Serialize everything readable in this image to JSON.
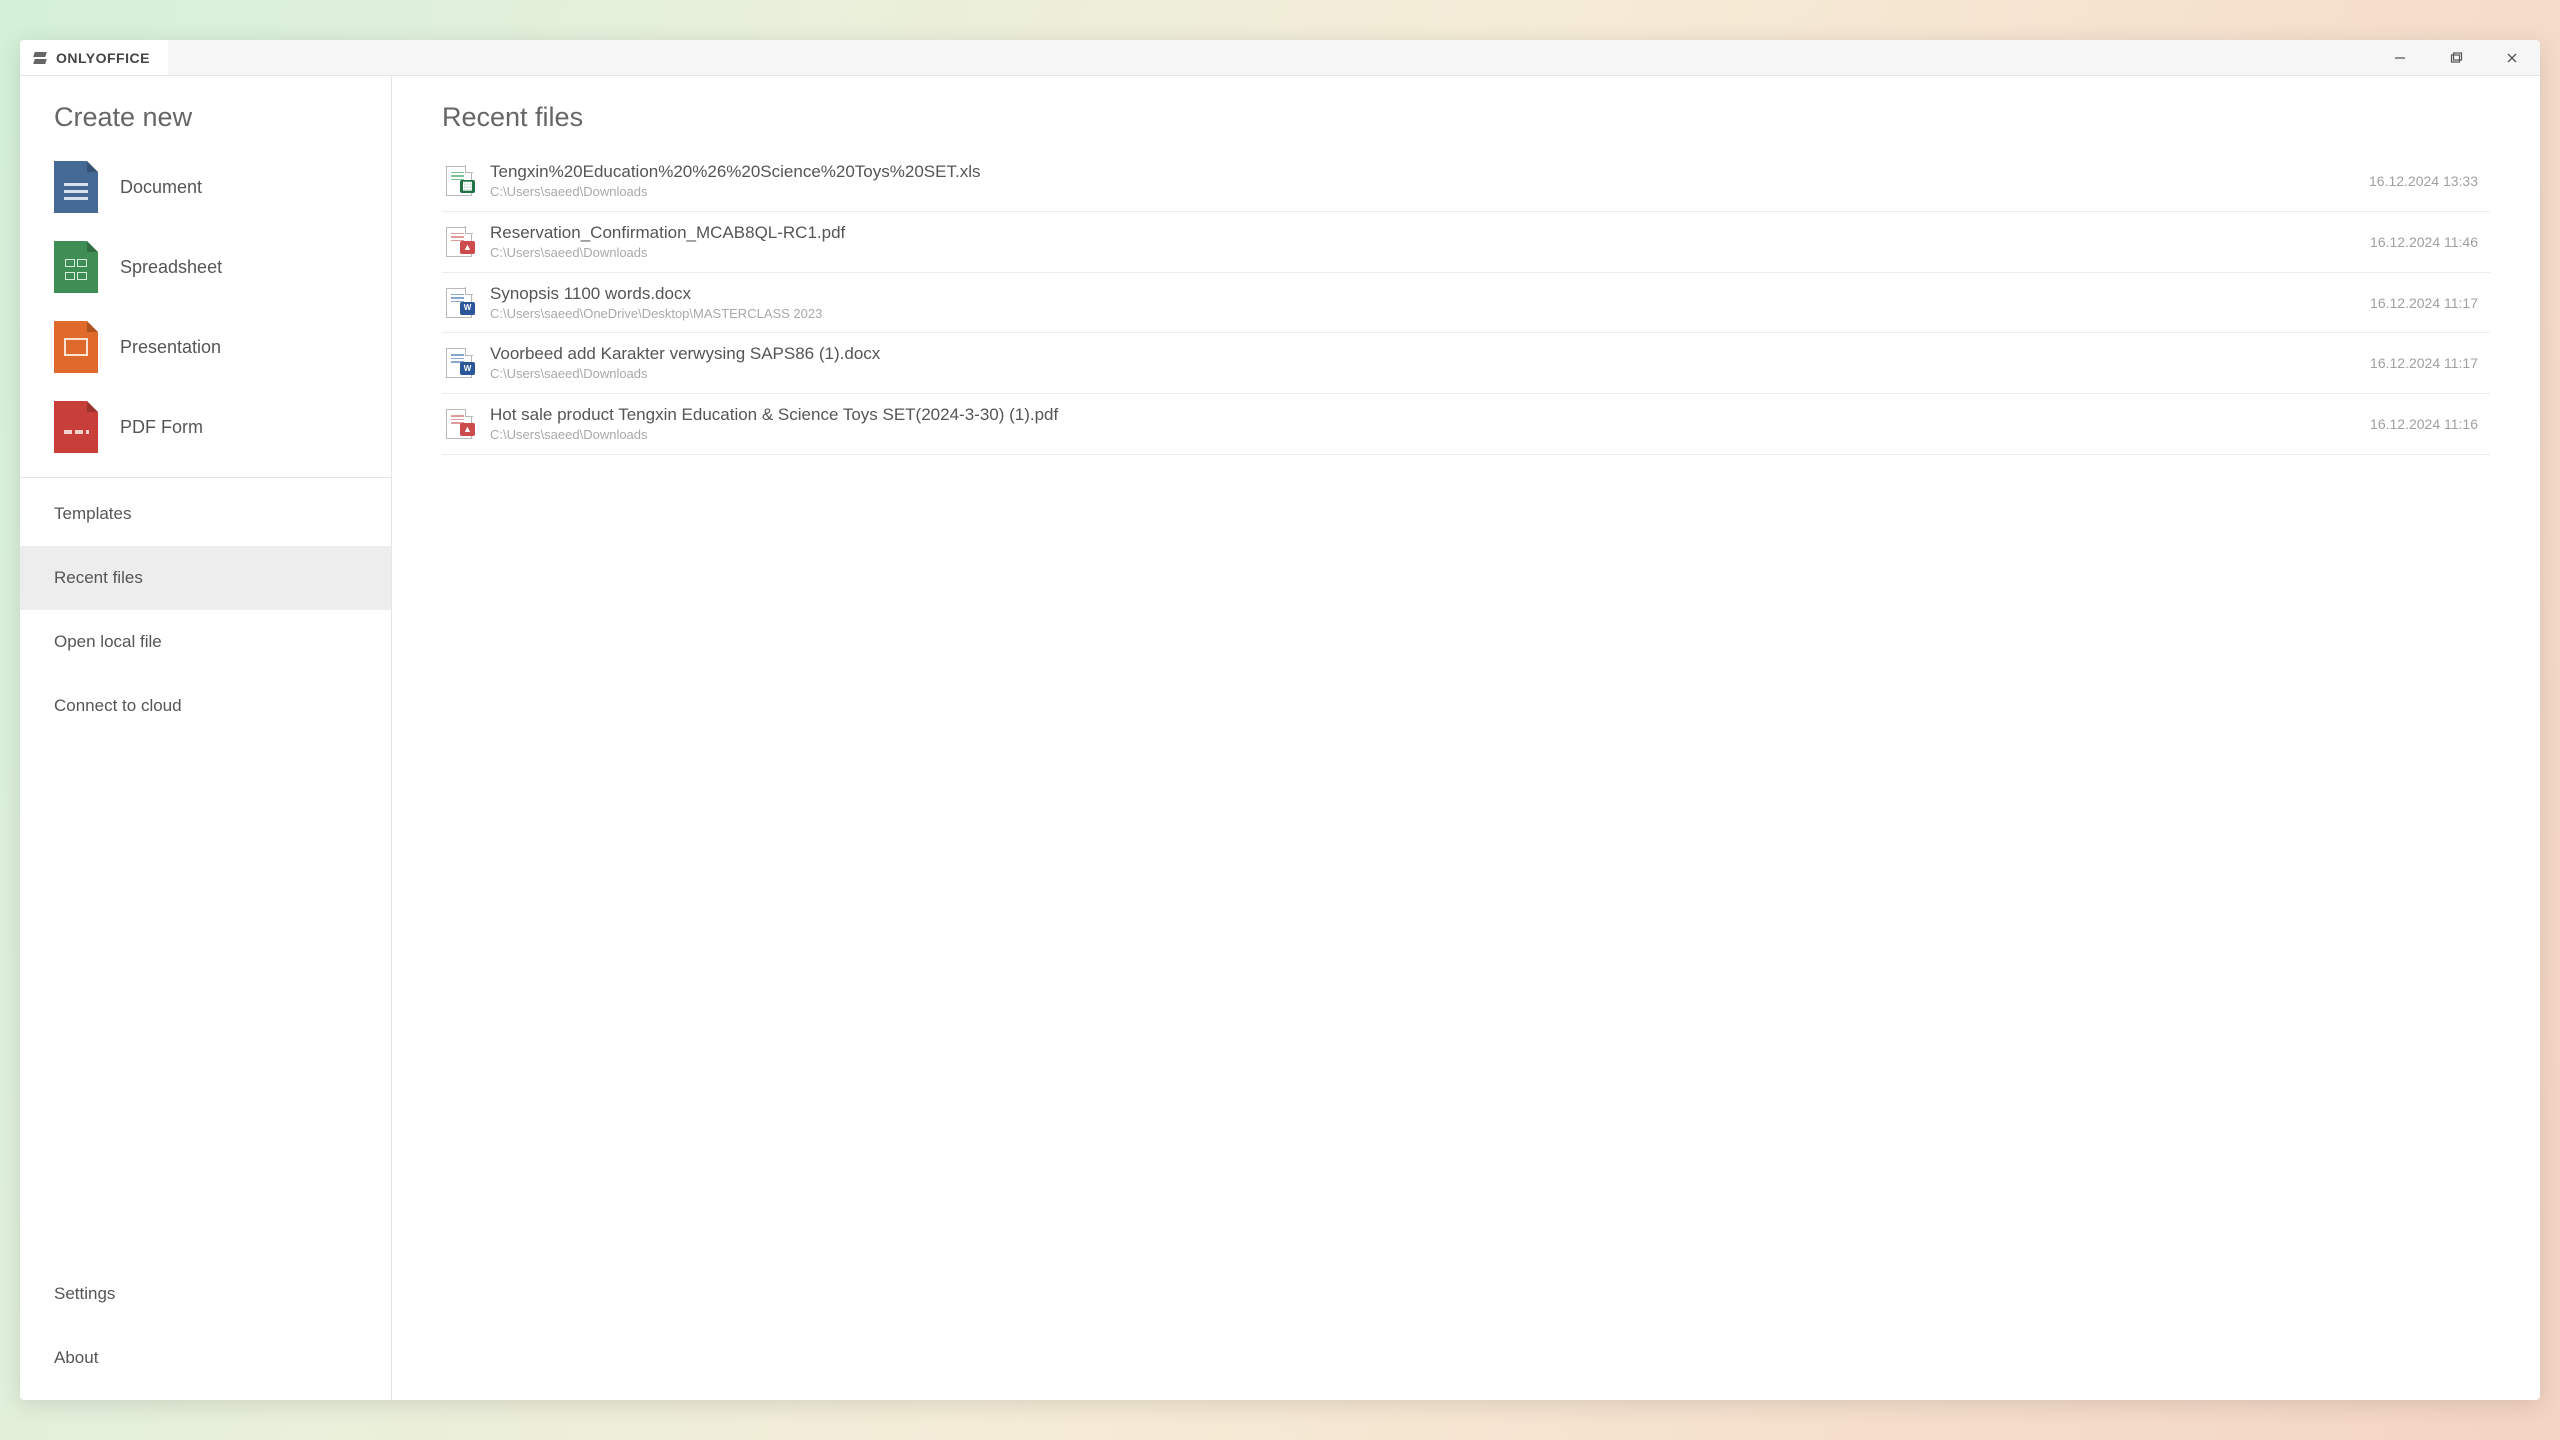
{
  "titlebar": {
    "app_name": "ONLYOFFICE"
  },
  "sidebar": {
    "create_heading": "Create new",
    "create_items": [
      {
        "label": "Document",
        "icon": "doc-blue"
      },
      {
        "label": "Spreadsheet",
        "icon": "doc-green"
      },
      {
        "label": "Presentation",
        "icon": "doc-orange"
      },
      {
        "label": "PDF Form",
        "icon": "doc-red"
      }
    ],
    "nav_items": [
      {
        "label": "Templates",
        "active": false
      },
      {
        "label": "Recent files",
        "active": true
      },
      {
        "label": "Open local file",
        "active": false
      },
      {
        "label": "Connect to cloud",
        "active": false
      }
    ],
    "bottom_items": [
      {
        "label": "Settings"
      },
      {
        "label": "About"
      }
    ]
  },
  "main": {
    "heading": "Recent files",
    "files": [
      {
        "type": "xls",
        "name": "Tengxin%20Education%20%26%20Science%20Toys%20SET.xls",
        "path": "C:\\Users\\saeed\\Downloads",
        "time": "16.12.2024 13:33"
      },
      {
        "type": "pdf",
        "name": "Reservation_Confirmation_MCAB8QL-RC1.pdf",
        "path": "C:\\Users\\saeed\\Downloads",
        "time": "16.12.2024 11:46"
      },
      {
        "type": "docx",
        "name": "Synopsis 1100 words.docx",
        "path": "C:\\Users\\saeed\\OneDrive\\Desktop\\MASTERCLASS 2023",
        "time": "16.12.2024 11:17"
      },
      {
        "type": "docx",
        "name": "Voorbeed add Karakter verwysing SAPS86 (1).docx",
        "path": "C:\\Users\\saeed\\Downloads",
        "time": "16.12.2024 11:17"
      },
      {
        "type": "pdf",
        "name": "Hot sale product Tengxin Education & Science Toys SET(2024-3-30) (1).pdf",
        "path": "C:\\Users\\saeed\\Downloads",
        "time": "16.12.2024 11:16"
      }
    ]
  }
}
